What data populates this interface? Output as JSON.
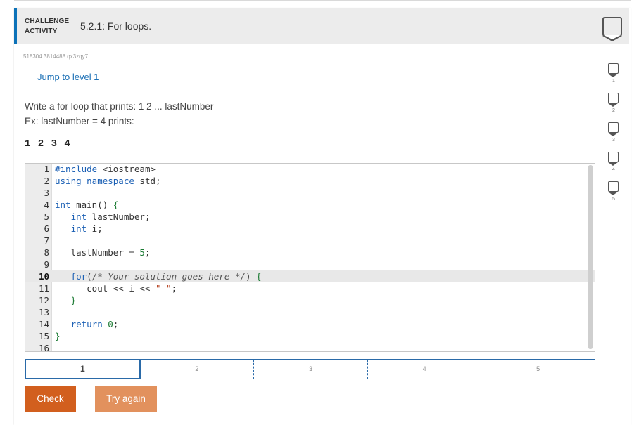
{
  "header": {
    "activity_type": "CHALLENGE ACTIVITY",
    "title": "5.2.1: For loops."
  },
  "activity_id": "518304.3814488.qx3zqy7",
  "jump_link": "Jump to level 1",
  "instructions": {
    "line1": "Write a for loop that prints: 1 2 ... lastNumber",
    "line2": "Ex: lastNumber = 4 prints:"
  },
  "example_output": "1 2 3 4",
  "editor": {
    "active_line": 10,
    "lines": [
      {
        "n": "1",
        "html": "<span class=\"kw\">#include</span> &lt;iostream&gt;"
      },
      {
        "n": "2",
        "html": "<span class=\"kw\">using namespace</span> std;"
      },
      {
        "n": "3",
        "html": ""
      },
      {
        "n": "4",
        "html": "<span class=\"kw\">int</span> main() <span class=\"brk\">{</span>"
      },
      {
        "n": "5",
        "html": "   <span class=\"kw\">int</span> lastNumber;"
      },
      {
        "n": "6",
        "html": "   <span class=\"kw\">int</span> i;"
      },
      {
        "n": "7",
        "html": ""
      },
      {
        "n": "8",
        "html": "   lastNumber = <span class=\"num\">5</span>;"
      },
      {
        "n": "9",
        "html": ""
      },
      {
        "n": "10",
        "html": "   <span class=\"kw\">for</span>(<span class=\"cm\">/* Your solution goes here */</span>) <span class=\"brk\">{</span>"
      },
      {
        "n": "11",
        "html": "      cout &lt;&lt; i &lt;&lt; <span class=\"str\">\" \"</span>;"
      },
      {
        "n": "12",
        "html": "   <span class=\"brk\">}</span>"
      },
      {
        "n": "13",
        "html": ""
      },
      {
        "n": "14",
        "html": "   <span class=\"kw\">return</span> <span class=\"num\">0</span>;"
      },
      {
        "n": "15",
        "html": "<span class=\"brk\">}</span>"
      },
      {
        "n": "16",
        "html": ""
      }
    ]
  },
  "levels": [
    "1",
    "2",
    "3",
    "4",
    "5"
  ],
  "current_level": "1",
  "buttons": {
    "check": "Check",
    "try_again": "Try again"
  },
  "side_levels": [
    "1",
    "2",
    "3",
    "4",
    "5"
  ],
  "colors": {
    "accent": "#0c72b8",
    "check_button": "#d25f1e",
    "try_again_button": "#e2915d",
    "link": "#1a6fb5"
  }
}
